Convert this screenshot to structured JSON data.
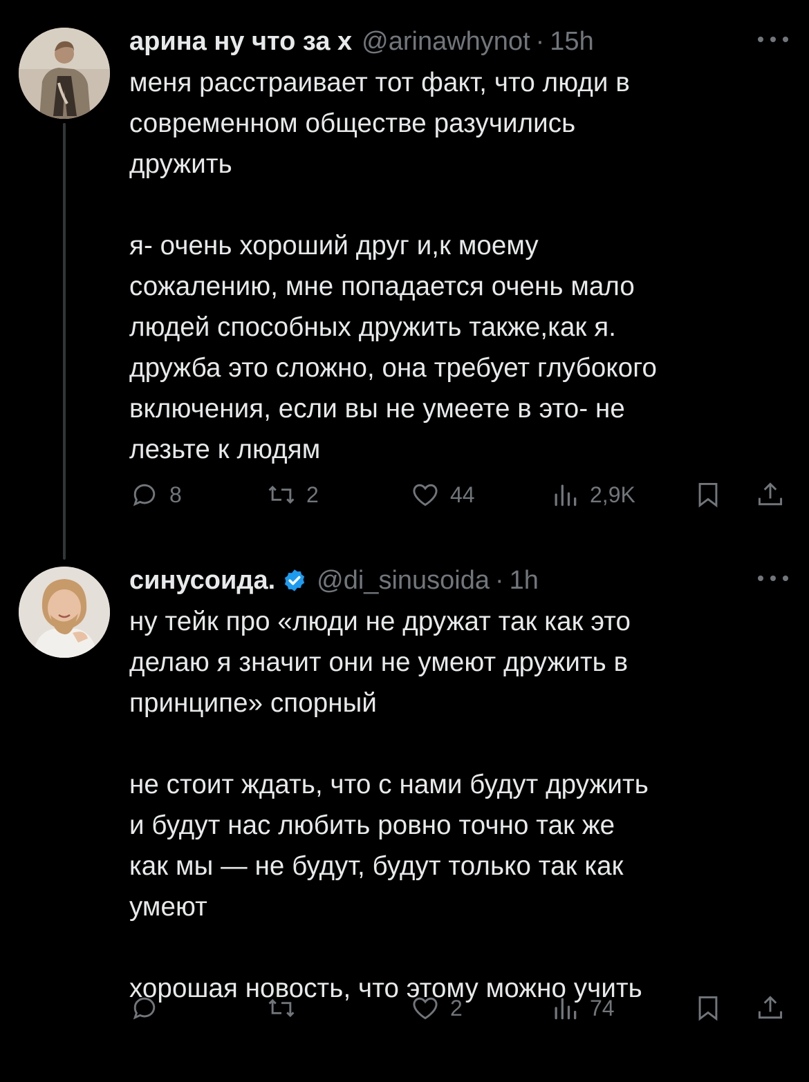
{
  "tweets": [
    {
      "display_name": "арина ну что за х",
      "handle": "@arinawhynot",
      "separator": "·",
      "time": "15h",
      "verified": false,
      "text": "меня расстраивает тот факт, что люди в\nсовременном обществе разучились\nдружить\n\nя- очень хороший друг и,к моему\nсожалению, мне попадается очень мало\nлюдей способных дружить также,как я.\nдружба это сложно, она требует глубокого\nвключения, если вы не умеете в это- не\nлезьте к людям",
      "replies": "8",
      "reposts": "2",
      "likes": "44",
      "views": "2,9K"
    },
    {
      "display_name": "синусоида.",
      "handle": "@di_sinusoida",
      "separator": "·",
      "time": "1h",
      "verified": true,
      "text": "ну тейк про «люди не дружат так как это\nделаю я значит они не умеют дружить в\nпринципе» спорный\n\nне стоит ждать, что с нами будут дружить\nи будут нас любить ровно точно так же\nкак мы — не будут, будут только так как\nумеют\n\nхорошая новость, что этому можно учить",
      "replies": "",
      "reposts": "",
      "likes": "2",
      "views": "74"
    }
  ],
  "colors": {
    "background": "#000000",
    "text": "#e7e9ea",
    "muted": "#71767b",
    "verified": "#1d9bf0",
    "thread_line": "#333639"
  },
  "icons": [
    "reply-icon",
    "repost-icon",
    "like-icon",
    "views-icon",
    "bookmark-icon",
    "share-icon",
    "more-icon",
    "verified-badge-icon"
  ]
}
